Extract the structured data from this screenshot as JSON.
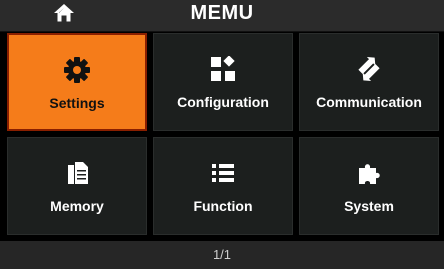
{
  "header": {
    "title": "MEMU",
    "home_icon": "home-icon"
  },
  "menu": {
    "selected": "Settings",
    "items": [
      {
        "label": "Settings",
        "icon": "gear-icon"
      },
      {
        "label": "Configuration",
        "icon": "blocks-icon"
      },
      {
        "label": "Communication",
        "icon": "exchange-arrows-icon"
      },
      {
        "label": "Memory",
        "icon": "documents-icon"
      },
      {
        "label": "Function",
        "icon": "list-icon"
      },
      {
        "label": "System",
        "icon": "puzzle-icon"
      }
    ]
  },
  "footer": {
    "page_indicator": "1/1"
  },
  "colors": {
    "accent": "#f57c1a",
    "tile_bg": "#1c1f1e",
    "background": "#000000"
  }
}
